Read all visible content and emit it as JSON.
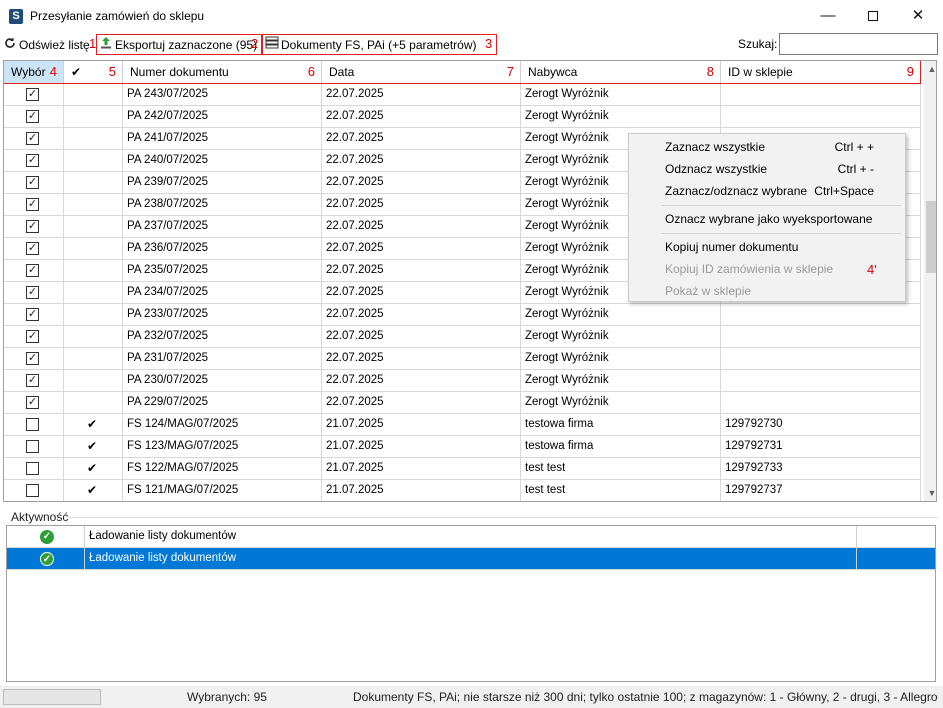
{
  "window": {
    "title": "Przesyłanie zamówień do sklepu",
    "app_icon_letter": "S",
    "min_glyph": "—",
    "close_glyph": "✕"
  },
  "toolbar": {
    "refresh_label": "Odśwież listę",
    "refresh_icon": "refresh-icon",
    "refresh_num": "1",
    "export_label": "Eksportuj zaznaczone (95)",
    "export_icon": "upload-icon",
    "export_num": "2",
    "documents_label": "Dokumenty FS, PAi (+5 parametrów)",
    "documents_icon": "stack-icon",
    "documents_num": "3",
    "search_label": "Szukaj:",
    "search_value": ""
  },
  "grid": {
    "columns": [
      {
        "label": "Wybór",
        "num": "4"
      },
      {
        "label": "✔",
        "num": "5"
      },
      {
        "label": "Numer dokumentu",
        "num": "6"
      },
      {
        "label": "Data",
        "num": "7"
      },
      {
        "label": "Nabywca",
        "num": "8"
      },
      {
        "label": "ID w sklepie",
        "num": "9"
      }
    ],
    "rows": [
      {
        "checked": true,
        "exported": false,
        "doc": "PA 243/07/2025",
        "date": "22.07.2025",
        "buyer": "Zerogt Wyróżnik",
        "shop_id": ""
      },
      {
        "checked": true,
        "exported": false,
        "doc": "PA 242/07/2025",
        "date": "22.07.2025",
        "buyer": "Zerogt Wyróżnik",
        "shop_id": ""
      },
      {
        "checked": true,
        "exported": false,
        "doc": "PA 241/07/2025",
        "date": "22.07.2025",
        "buyer": "Zerogt Wyróżnik",
        "shop_id": ""
      },
      {
        "checked": true,
        "exported": false,
        "doc": "PA 240/07/2025",
        "date": "22.07.2025",
        "buyer": "Zerogt Wyróżnik",
        "shop_id": ""
      },
      {
        "checked": true,
        "exported": false,
        "doc": "PA 239/07/2025",
        "date": "22.07.2025",
        "buyer": "Zerogt Wyróżnik",
        "shop_id": ""
      },
      {
        "checked": true,
        "exported": false,
        "doc": "PA 238/07/2025",
        "date": "22.07.2025",
        "buyer": "Zerogt Wyróżnik",
        "shop_id": ""
      },
      {
        "checked": true,
        "exported": false,
        "doc": "PA 237/07/2025",
        "date": "22.07.2025",
        "buyer": "Zerogt Wyróżnik",
        "shop_id": ""
      },
      {
        "checked": true,
        "exported": false,
        "doc": "PA 236/07/2025",
        "date": "22.07.2025",
        "buyer": "Zerogt Wyróżnik",
        "shop_id": ""
      },
      {
        "checked": true,
        "exported": false,
        "doc": "PA 235/07/2025",
        "date": "22.07.2025",
        "buyer": "Zerogt Wyróżnik",
        "shop_id": ""
      },
      {
        "checked": true,
        "exported": false,
        "doc": "PA 234/07/2025",
        "date": "22.07.2025",
        "buyer": "Zerogt Wyróżnik",
        "shop_id": ""
      },
      {
        "checked": true,
        "exported": false,
        "doc": "PA 233/07/2025",
        "date": "22.07.2025",
        "buyer": "Zerogt Wyróżnik",
        "shop_id": ""
      },
      {
        "checked": true,
        "exported": false,
        "doc": "PA 232/07/2025",
        "date": "22.07.2025",
        "buyer": "Zerogt Wyróżnik",
        "shop_id": ""
      },
      {
        "checked": true,
        "exported": false,
        "doc": "PA 231/07/2025",
        "date": "22.07.2025",
        "buyer": "Zerogt Wyróżnik",
        "shop_id": ""
      },
      {
        "checked": true,
        "exported": false,
        "doc": "PA 230/07/2025",
        "date": "22.07.2025",
        "buyer": "Zerogt Wyróżnik",
        "shop_id": ""
      },
      {
        "checked": true,
        "exported": false,
        "doc": "PA 229/07/2025",
        "date": "22.07.2025",
        "buyer": "Zerogt Wyróżnik",
        "shop_id": ""
      },
      {
        "checked": false,
        "exported": true,
        "doc": "FS 124/MAG/07/2025",
        "date": "21.07.2025",
        "buyer": "testowa firma",
        "shop_id": "129792730"
      },
      {
        "checked": false,
        "exported": true,
        "doc": "FS 123/MAG/07/2025",
        "date": "21.07.2025",
        "buyer": "testowa firma",
        "shop_id": "129792731"
      },
      {
        "checked": false,
        "exported": true,
        "doc": "FS 122/MAG/07/2025",
        "date": "21.07.2025",
        "buyer": "test test",
        "shop_id": "129792733"
      },
      {
        "checked": false,
        "exported": true,
        "doc": "FS 121/MAG/07/2025",
        "date": "21.07.2025",
        "buyer": "test test",
        "shop_id": "129792737"
      }
    ]
  },
  "context_menu": {
    "num": "4'",
    "items": [
      {
        "label": "Zaznacz wszystkie",
        "shortcut": "Ctrl + +",
        "enabled": true
      },
      {
        "label": "Odznacz wszystkie",
        "shortcut": "Ctrl + -",
        "enabled": true
      },
      {
        "label": "Zaznacz/odznacz wybrane",
        "shortcut": "Ctrl+Space",
        "enabled": true
      },
      {
        "label": "Oznacz wybrane jako wyeksportowane",
        "shortcut": "",
        "enabled": true
      },
      {
        "label": "Kopiuj numer dokumentu",
        "shortcut": "",
        "enabled": true
      },
      {
        "label": "Kopiuj ID zamówienia w sklepie",
        "shortcut": "",
        "enabled": false
      },
      {
        "label": "Pokaż w sklepie",
        "shortcut": "",
        "enabled": false
      }
    ]
  },
  "activity": {
    "label": "Aktywność",
    "rows": [
      {
        "status_icon": "check-circle-icon",
        "text": "Ładowanie listy dokumentów",
        "selected": false
      },
      {
        "status_icon": "check-circle-icon",
        "text": "Ładowanie listy dokumentów",
        "selected": true
      }
    ]
  },
  "status_bar": {
    "selected_count": "Wybranych: 95",
    "filter_info": "Dokumenty FS, PAi; nie starsze niż 300 dni; tylko ostatnie 100; z magazynów: 1 - Główny, 2 - drugi, 3 - Allegro"
  },
  "colors": {
    "accent": "#0078d7",
    "annotation_red": "#d40000",
    "success_green": "#2e9e37",
    "header_selected": "#cce4f7"
  }
}
